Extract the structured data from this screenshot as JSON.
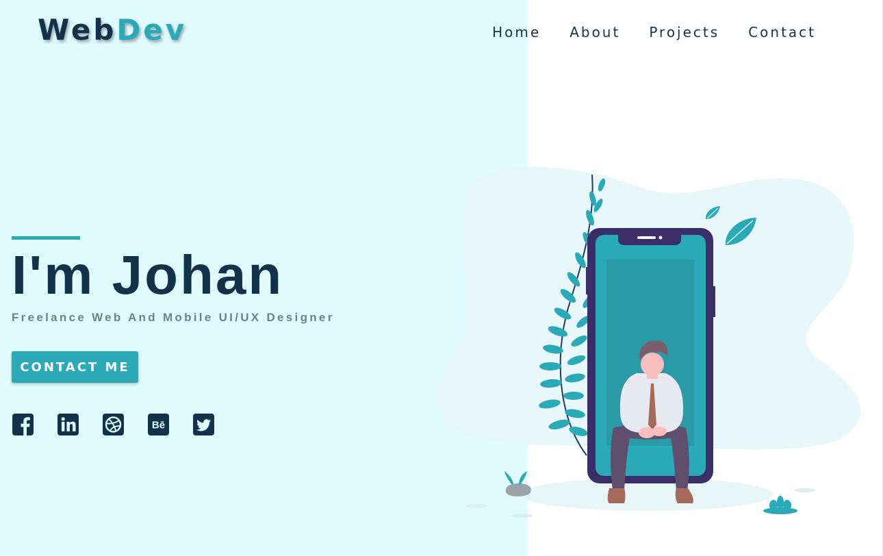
{
  "logo": {
    "part_a": "Web",
    "part_b": "Dev"
  },
  "nav": [
    {
      "label": "Home"
    },
    {
      "label": "About"
    },
    {
      "label": "Projects"
    },
    {
      "label": "Contact"
    }
  ],
  "hero": {
    "title": "I'm Johan",
    "subtitle": "Freelance Web And Mobile UI/UX Designer",
    "cta_label": "CONTACT ME"
  },
  "socials": [
    {
      "icon": "facebook-icon"
    },
    {
      "icon": "linkedin-icon"
    },
    {
      "icon": "dribbble-icon"
    },
    {
      "icon": "behance-icon",
      "glyph": "Bē"
    },
    {
      "icon": "twitter-icon"
    }
  ],
  "colors": {
    "accent": "#2aaab7",
    "dark": "#13324a",
    "panel_bg": "#dffbfe",
    "subtitle": "#6a8194"
  }
}
